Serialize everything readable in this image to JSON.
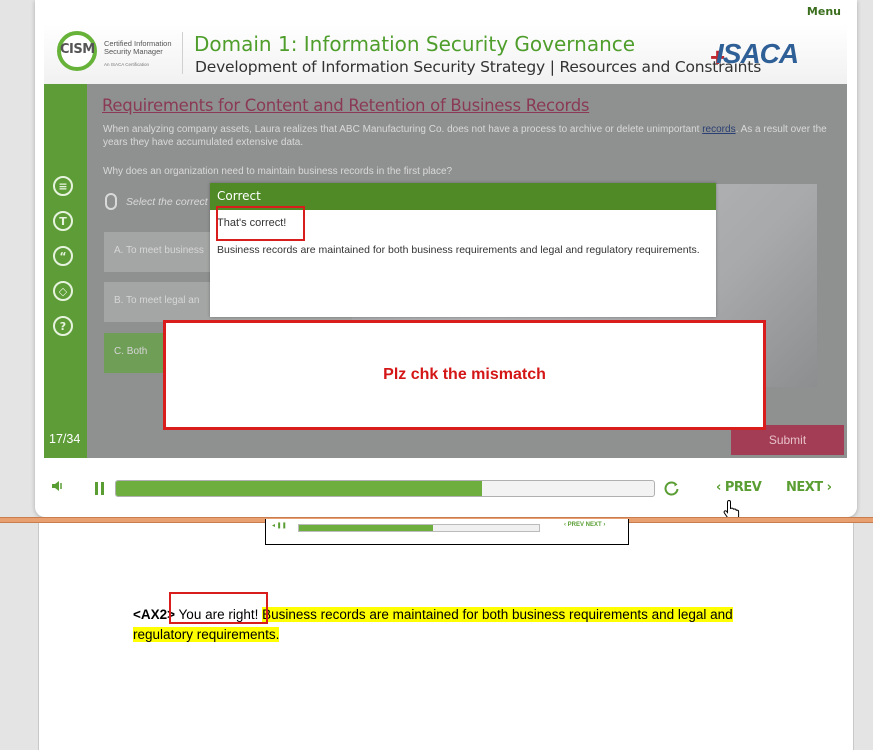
{
  "player": {
    "menu_label": "Menu",
    "header": {
      "logo_text": "CISM",
      "cert_line1": "Certified Information",
      "cert_line2": "Security Manager",
      "cert_line3": "An ISACA Certification",
      "domain_title": "Domain 1: Information Security Governance",
      "domain_subtitle": "Development of Information Security Strategy | Resources and Constraints",
      "brand": "ISACA"
    },
    "rail": {
      "icons": [
        "notes-icon",
        "transcript-icon",
        "quote-icon",
        "layers-icon",
        "help-icon"
      ],
      "counter": "17/34"
    },
    "slide": {
      "title": "Requirements for Content and Retention of Business Records",
      "intro_before_link": "When analyzing company assets, Laura realizes that ABC Manufacturing Co. does not have a process to archive or delete unimportant ",
      "intro_link": "records",
      "intro_after_link": ". As a result over the years they have accumulated extensive data.",
      "question": "Why does an organization need to maintain business records in the first place?",
      "instruction": "Select the correct",
      "options": [
        {
          "label": "A.  To meet business"
        },
        {
          "label": "B.  To meet legal an"
        },
        {
          "label": "C.  Both"
        }
      ],
      "submit_label": "Submit"
    },
    "feedback": {
      "header": "Correct",
      "line1": "That's correct!",
      "line2": "Business records are maintained for both business requirements and legal and regulatory requirements."
    },
    "controls": {
      "progress_percent": 68,
      "prev_label": "PREV",
      "next_label": "NEXT"
    }
  },
  "review": {
    "callout_text": "Plz chk the mismatch"
  },
  "document": {
    "thumb_nav": "‹ PREV   NEXT ›",
    "tag": "<AX2>",
    "prefix": "You are right!",
    "highlighted": "Business records are maintained for both business requirements and legal and regulatory requirements."
  },
  "colors": {
    "brand_green": "#5e9c37",
    "alert_red": "#d91c1c",
    "highlight_yellow": "#ffff00"
  }
}
